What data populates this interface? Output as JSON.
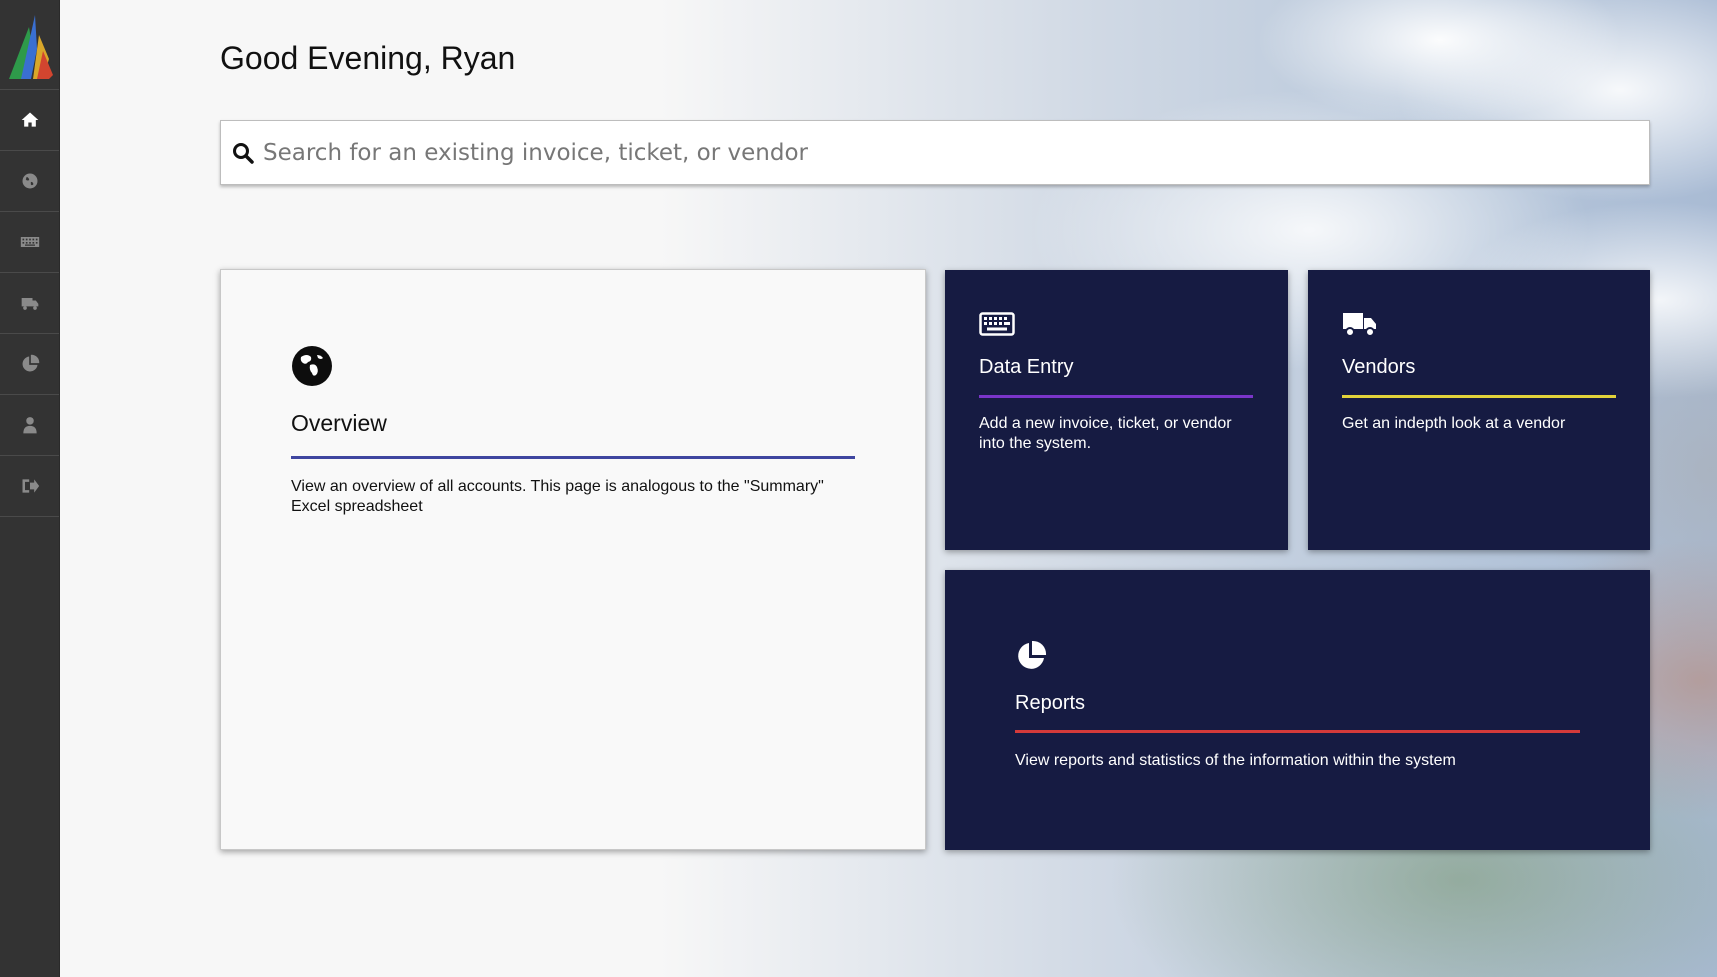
{
  "sidebar": {
    "logo_icon": "app-logo-icon",
    "items": [
      {
        "icon": "home-icon",
        "active": true
      },
      {
        "icon": "globe-icon",
        "active": false
      },
      {
        "icon": "keyboard-icon",
        "active": false
      },
      {
        "icon": "truck-icon",
        "active": false
      },
      {
        "icon": "pie-chart-icon",
        "active": false
      },
      {
        "icon": "user-icon",
        "active": false
      },
      {
        "icon": "sign-out-icon",
        "active": false
      }
    ]
  },
  "header": {
    "greeting": "Good Evening, Ryan"
  },
  "search": {
    "placeholder": "Search for an existing invoice, ticket, or vendor",
    "value": ""
  },
  "cards": {
    "overview": {
      "icon": "globe-icon",
      "title": "Overview",
      "description": "View an overview of all accounts. This page is analogous to the \"Summary\" Excel spreadsheet",
      "accent": "#3f46a0"
    },
    "data_entry": {
      "icon": "keyboard-icon",
      "title": "Data Entry",
      "description": "Add a new invoice, ticket, or vendor into the system.",
      "accent": "#7a35c9"
    },
    "vendors": {
      "icon": "truck-icon",
      "title": "Vendors",
      "description": "Get an indepth look at a vendor",
      "accent": "#e2d23a"
    },
    "reports": {
      "icon": "pie-chart-icon",
      "title": "Reports",
      "description": "View reports and statistics of the information within the system",
      "accent": "#d43a3a"
    }
  },
  "colors": {
    "sidebar_bg": "#333333",
    "card_dark_bg": "#161b42"
  }
}
